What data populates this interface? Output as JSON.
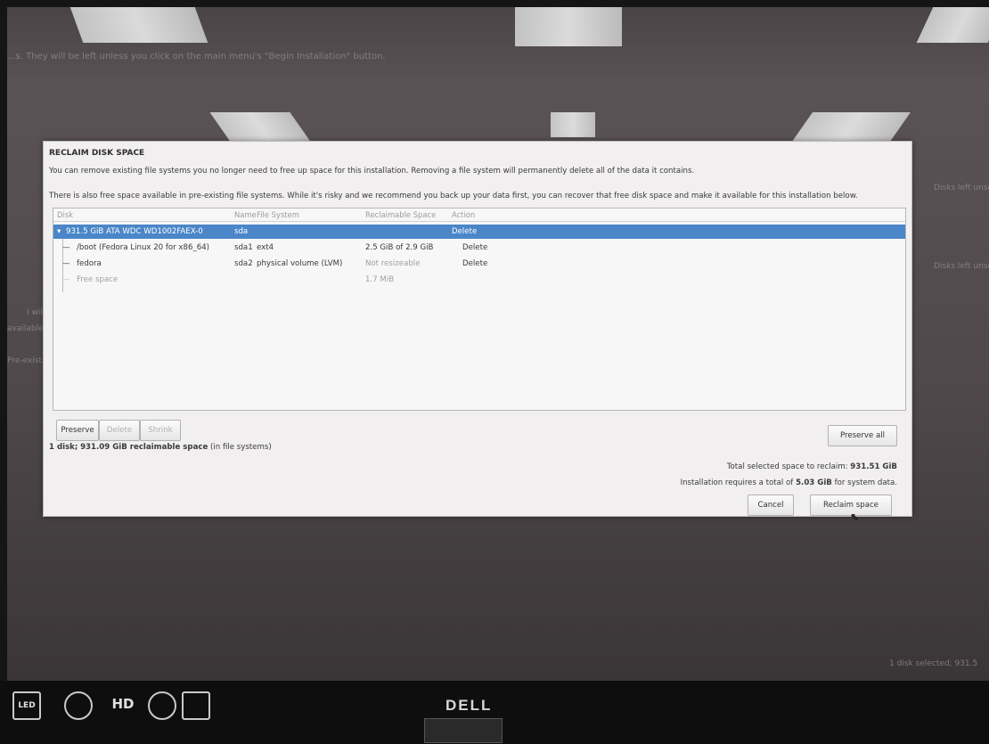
{
  "background": {
    "top_notice": "...s. They will be left unless you click on the main menu's \"Begin Installation\" button.",
    "right_text_1": "Disks left unse",
    "right_text_2": "Disks left unse",
    "left_text_1": "I wil",
    "left_text_2": "available",
    "left_text_3": "Pre-exist",
    "bottom_right": "1 disk selected; 931.5"
  },
  "dialog": {
    "title": "RECLAIM DISK SPACE",
    "line1": "You can remove existing file systems you no longer need to free up space for this installation.  Removing a file system will permanently delete all of the data it contains.",
    "line2": "There is also free space available in pre-existing file systems.  While it's risky and we recommend you back up your data first, you can recover that free disk space and make it available for this installation below.",
    "columns": [
      "Disk",
      "Name",
      "File System",
      "Reclaimable Space",
      "Action"
    ],
    "rows": [
      {
        "disk": "931.5 GiB ATA WDC WD1002FAEX-0",
        "name": "sda",
        "fs": "",
        "reclaim": "",
        "action": "Delete"
      },
      {
        "disk": "/boot (Fedora Linux 20 for x86_64)",
        "name": "sda1",
        "fs": "ext4",
        "reclaim": "2.5 GiB of 2.9 GiB",
        "action": "Delete"
      },
      {
        "disk": "fedora",
        "name": "sda2",
        "fs": "physical volume (LVM)",
        "reclaim": "Not resizeable",
        "action": "Delete"
      },
      {
        "disk": "Free space",
        "name": "",
        "fs": "",
        "reclaim": "1.7 MiB",
        "action": ""
      }
    ],
    "buttons": {
      "preserve": "Preserve",
      "delete": "Delete",
      "shrink": "Shrink",
      "preserve_all": "Preserve all",
      "cancel": "Cancel",
      "reclaim": "Reclaim space"
    },
    "summary": {
      "disk_count": "1 disk;",
      "reclaimable": "931.09 GiB reclaimable space",
      "suffix": "(in file systems)"
    },
    "total_prefix": "Total selected space to reclaim:",
    "total_value": "931.51 GiB",
    "requires_prefix": "Installation requires a total of",
    "requires_value": "5.03 GiB",
    "requires_suffix": "for system data."
  },
  "bezel": {
    "brand": "DELL",
    "badges": [
      "LED",
      "HD"
    ]
  },
  "colors": {
    "selection": "#4a86c8",
    "dialog_bg": "#f1efef"
  }
}
